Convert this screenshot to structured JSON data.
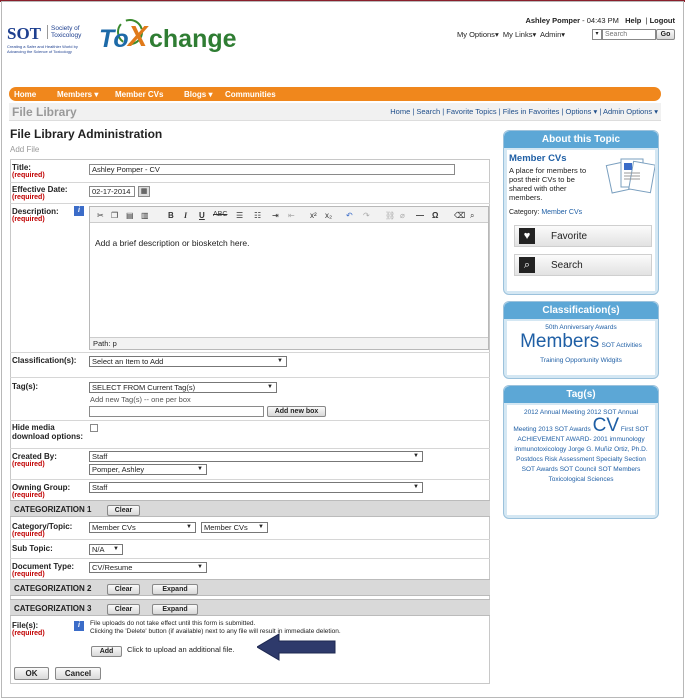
{
  "header": {
    "user": "Ashley Pomper",
    "time": "- 04:43 PM",
    "help": "Help",
    "logout": "Logout",
    "options": [
      "My Options",
      "My Links",
      "Admin"
    ],
    "search_placeholder": "Search",
    "go": "Go",
    "sot_logo": "SOT",
    "sot_society": "Society of",
    "sot_tox": "Toxicology",
    "sot_tagline": "Creating a Safer and Healthier World by Advancing the Science of Toxicology",
    "brand_to": "To",
    "brand_x": "X",
    "brand_change": "change"
  },
  "nav": {
    "items": [
      "Home",
      "Members",
      "Member CVs",
      "Blogs",
      "Communities"
    ]
  },
  "subnav": {
    "title": "File Library",
    "links": [
      "Home",
      "Search",
      "Favorite Topics",
      "Files in Favorites",
      "Options",
      "Admin Options"
    ]
  },
  "form": {
    "heading": "File Library Administration",
    "subheading": "Add File",
    "required": "(required)",
    "title_label": "Title:",
    "title_value": "Ashley Pomper - CV",
    "date_label": "Effective Date:",
    "date_value": "02-17-2014",
    "desc_label": "Description:",
    "desc_text": "Add a brief description or biosketch here.",
    "desc_path": "Path: p",
    "class_label": "Classification(s):",
    "class_value": "Select an Item to Add",
    "tags_label": "Tag(s):",
    "tags_select": "SELECT FROM Current Tag(s)",
    "tags_hint": "Add new Tag(s) -- one per box",
    "add_box": "Add new box",
    "hide_label": "Hide media download options:",
    "created_label": "Created By:",
    "created_group": "Staff",
    "created_user": "Pomper, Ashley",
    "owning_label": "Owning Group:",
    "owning_value": "Staff",
    "cat1": "CATEGORIZATION 1",
    "clear": "Clear",
    "expand": "Expand",
    "cat_topic_label": "Category/Topic:",
    "cat_value1": "Member CVs",
    "cat_value2": "Member CVs",
    "subtopic_label": "Sub Topic:",
    "subtopic_value": "N/A",
    "doctype_label": "Document Type:",
    "doctype_value": "CV/Resume",
    "cat2": "CATEGORIZATION 2",
    "cat3": "CATEGORIZATION 3",
    "files_label": "File(s):",
    "files_note1": "File uploads do not take effect until this form is submitted.",
    "files_note2": "Clicking the 'Delete' button (if available) next to any file will result in immediate deletion.",
    "add_btn": "Add",
    "add_hint": "Click to upload an additional file.",
    "ok": "OK",
    "cancel": "Cancel"
  },
  "sidebar": {
    "about_title": "About this Topic",
    "topic_name": "Member CVs",
    "topic_desc": "A place for members to post their CVs to be shared with other members.",
    "category_label": "Category:",
    "category_value": "Member CVs",
    "favorite": "Favorite",
    "search": "Search",
    "class_title": "Classification(s)",
    "class_items": [
      "50th Anniversary Awards",
      "Members",
      "SOT Activities",
      "Training Opportunity Widgits"
    ],
    "tags_title": "Tag(s)",
    "tags_items": [
      "2012 Annual Meeting",
      "2012 SOT Annual Meeting",
      "2013 SOT Awards",
      "CV",
      "First SOT ACHIEVEMENT AWARD- 2001",
      "immunology",
      "immunotoxicology",
      "Jorge G. Muñiz Ortiz, Ph.D.",
      "Postdocs",
      "Risk Assessment Specialty Section",
      "SOT Awards",
      "SOT Council",
      "SOT Members",
      "Toxicological Sciences"
    ]
  },
  "colors": {
    "nav_orange": "#f0871c",
    "panel_blue": "#5ca7d6",
    "required_red": "#c00000",
    "arrow_navy": "#2e3a6b"
  }
}
